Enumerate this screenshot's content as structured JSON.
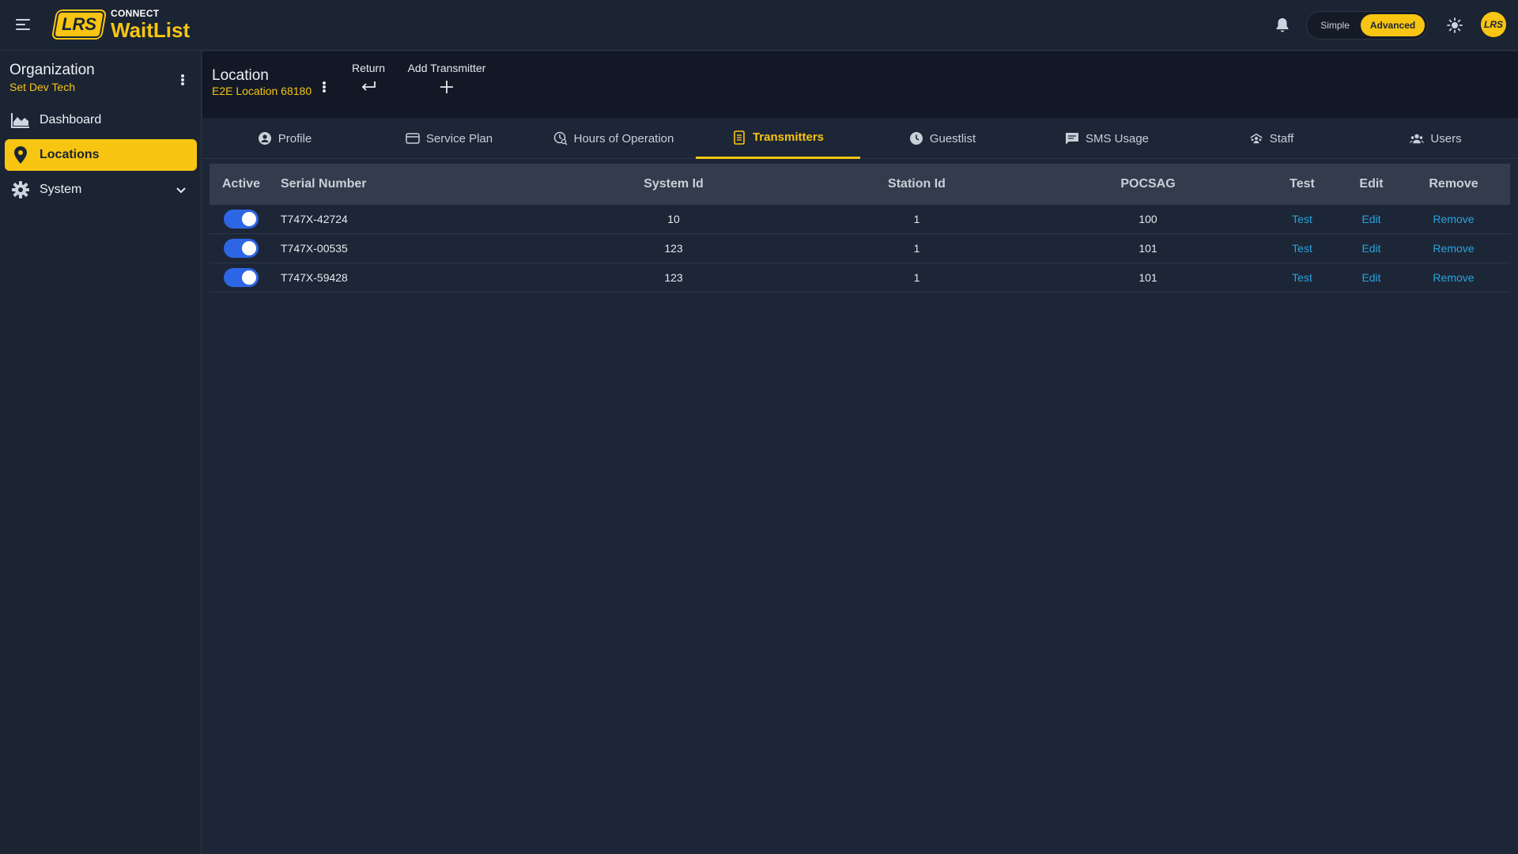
{
  "brand": {
    "logo_text": "LRS",
    "sub": "CONNECT",
    "name": "WaitList"
  },
  "topbar": {
    "mode": {
      "simple_label": "Simple",
      "advanced_label": "Advanced",
      "selected": "Advanced"
    },
    "avatar_text": "LRS"
  },
  "sidebar": {
    "org_title": "Organization",
    "org_name": "Set Dev Tech",
    "items": [
      {
        "label": "Dashboard",
        "icon": "chart-area-icon"
      },
      {
        "label": "Locations",
        "icon": "map-pin-icon",
        "active": true
      },
      {
        "label": "System",
        "icon": "gear-icon",
        "expandable": true
      }
    ]
  },
  "location": {
    "title": "Location",
    "name": "E2E Location 68180",
    "actions": {
      "return_label": "Return",
      "add_label": "Add Transmitter"
    }
  },
  "tabs": [
    {
      "label": "Profile",
      "icon": "user-circle-icon"
    },
    {
      "label": "Service Plan",
      "icon": "card-icon"
    },
    {
      "label": "Hours of Operation",
      "icon": "clock-search-icon"
    },
    {
      "label": "Transmitters",
      "icon": "document-icon",
      "active": true
    },
    {
      "label": "Guestlist",
      "icon": "clock-icon"
    },
    {
      "label": "SMS Usage",
      "icon": "message-icon"
    },
    {
      "label": "Staff",
      "icon": "staff-icon"
    },
    {
      "label": "Users",
      "icon": "users-icon"
    }
  ],
  "table": {
    "headers": {
      "active": "Active",
      "serial": "Serial Number",
      "system_id": "System Id",
      "station_id": "Station Id",
      "pocsag": "POCSAG",
      "test": "Test",
      "edit": "Edit",
      "remove": "Remove"
    },
    "rows": [
      {
        "active": true,
        "serial": "T747X-42724",
        "system_id": "10",
        "station_id": "1",
        "pocsag": "100",
        "test": "Test",
        "edit": "Edit",
        "remove": "Remove"
      },
      {
        "active": true,
        "serial": "T747X-00535",
        "system_id": "123",
        "station_id": "1",
        "pocsag": "101",
        "test": "Test",
        "edit": "Edit",
        "remove": "Remove"
      },
      {
        "active": true,
        "serial": "T747X-59428",
        "system_id": "123",
        "station_id": "1",
        "pocsag": "101",
        "test": "Test",
        "edit": "Edit",
        "remove": "Remove"
      }
    ]
  },
  "colors": {
    "accent": "#f7c512",
    "link": "#28a3e0",
    "toggle": "#2d66e4",
    "background": "#1d2636",
    "header_bg": "#121826"
  }
}
